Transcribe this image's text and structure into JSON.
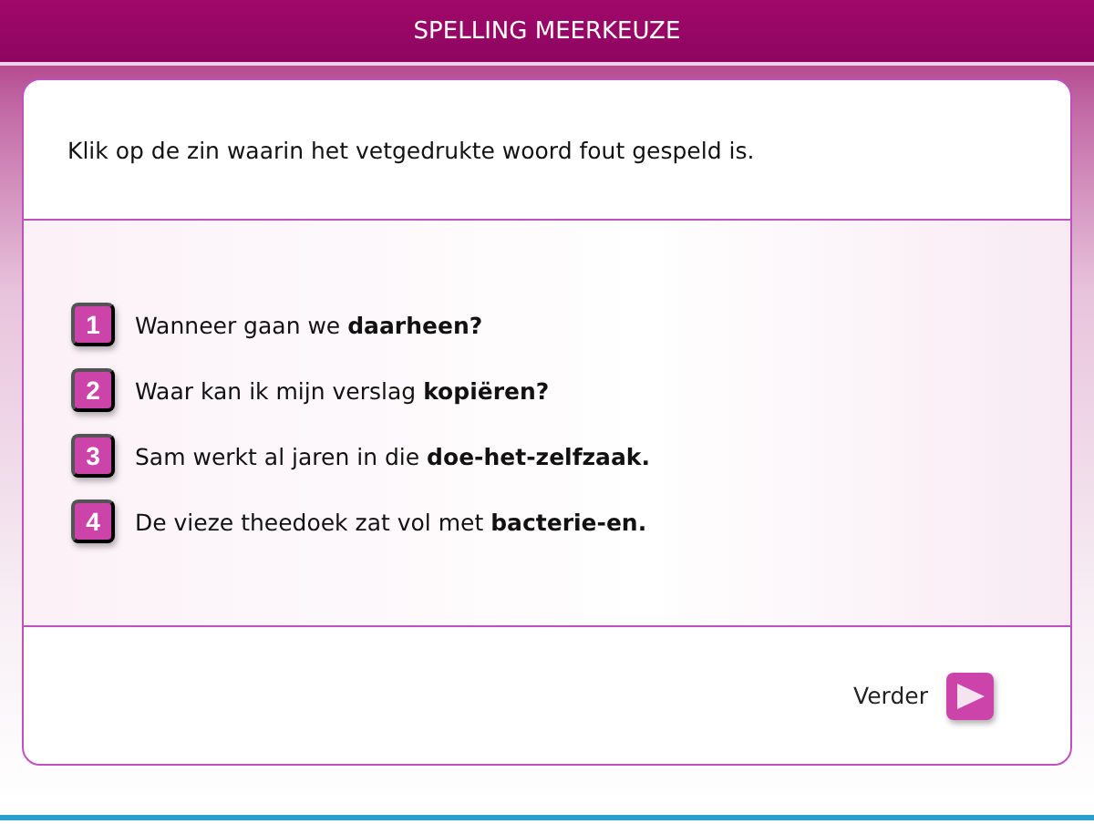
{
  "header": {
    "title": "SPELLING MEERKEUZE"
  },
  "instruction": "Klik op de zin waarin het vetgedrukte woord fout gespeld is.",
  "options": [
    {
      "number": "1",
      "text": "Wanneer gaan we **daarheen?**"
    },
    {
      "number": "2",
      "text": "Waar kan ik mijn verslag **kopiëren?**"
    },
    {
      "number": "3",
      "text": "Sam werkt al jaren in die **doe-het-zelfzaak.**"
    },
    {
      "number": "4",
      "text": "De vieze theedoek zat vol met **bacterie-en.**"
    }
  ],
  "next_button": {
    "label": "Verder"
  }
}
